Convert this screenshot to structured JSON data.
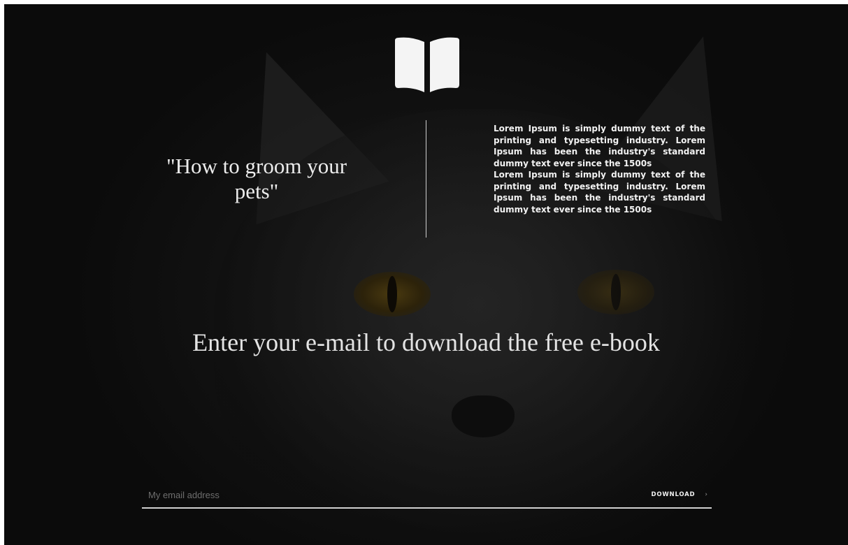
{
  "hero": {
    "ebook_title": "\"How to groom your pets\"",
    "description": [
      "Lorem Ipsum is simply dummy text of the printing and typesetting industry. Lorem Ipsum has been the industry's standard dummy text ever since the 1500s",
      "Lorem Ipsum is simply dummy text of the printing and typesetting industry. Lorem Ipsum has been the industry's standard dummy text ever since the 1500s"
    ],
    "headline": "Enter your e-mail to download the free e-book",
    "logo_icon": "open-book-icon"
  },
  "form": {
    "email_placeholder": "My email address",
    "email_value": "",
    "download_label": "DOWNLOAD",
    "download_icon": "chevron-right-icon"
  },
  "theme": {
    "background": "#121212",
    "text": "#ececec",
    "accent_eye": "#4a3a10"
  }
}
